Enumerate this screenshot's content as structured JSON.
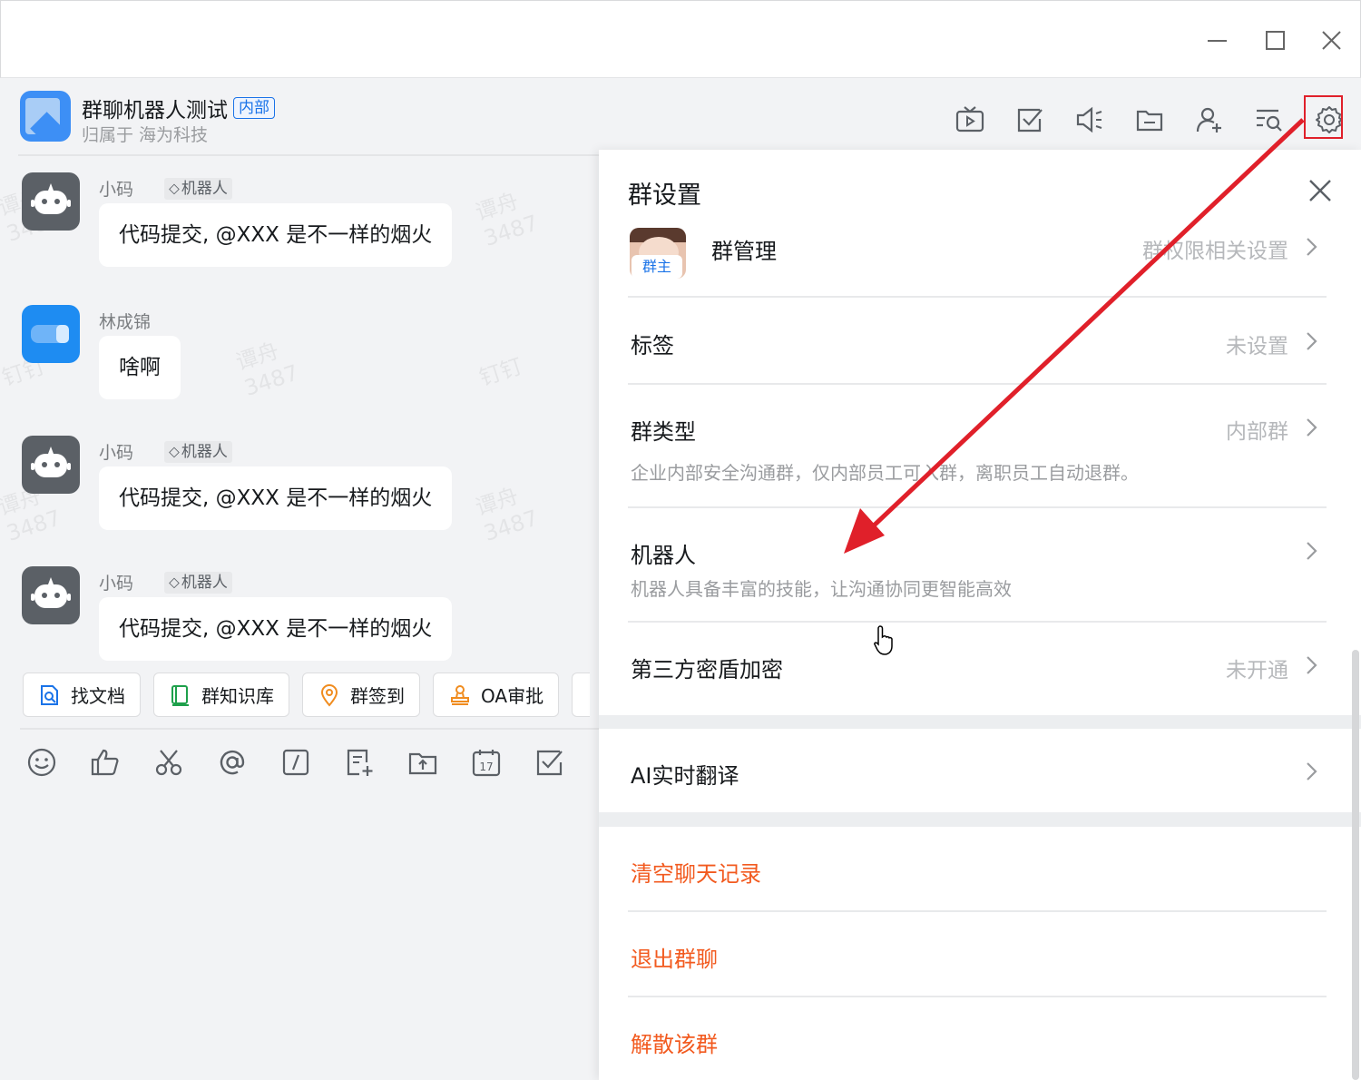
{
  "window": {
    "minimize_label": "minimize",
    "maximize_label": "maximize",
    "close_label": "close"
  },
  "header": {
    "group_name": "群聊机器人测试",
    "badge": "内部",
    "subtitle": "归属于 海为科技",
    "icons": [
      "live-icon",
      "todo-icon",
      "announcement-icon",
      "folder-icon",
      "add-member-icon",
      "search-history-icon",
      "gear-icon"
    ]
  },
  "messages": [
    {
      "sender": "小码",
      "tag": "机器人",
      "text": "代码提交, @XXX 是不一样的烟火",
      "type": "robot"
    },
    {
      "sender": "林成锦",
      "tag": "",
      "text": "啥啊",
      "type": "user"
    },
    {
      "sender": "小码",
      "tag": "机器人",
      "text": "代码提交, @XXX 是不一样的烟火",
      "type": "robot"
    },
    {
      "sender": "小码",
      "tag": "机器人",
      "text": "代码提交, @XXX 是不一样的烟火",
      "type": "robot"
    }
  ],
  "watermarks": [
    "谭舟\n3487",
    "钉钉"
  ],
  "quick_actions": [
    {
      "label": "找文档",
      "icon": "doc-search-icon",
      "color": "#1a73e8"
    },
    {
      "label": "群知识库",
      "icon": "knowledge-base-icon",
      "color": "#1ea04b"
    },
    {
      "label": "群签到",
      "icon": "checkin-icon",
      "color": "#f08c1f"
    },
    {
      "label": "OA审批",
      "icon": "approval-icon",
      "color": "#f08c1f"
    }
  ],
  "toolbar_icons": [
    "emoji-icon",
    "thumbs-up-icon",
    "scissors-icon",
    "at-icon",
    "slash-command-icon",
    "new-doc-icon",
    "upload-icon",
    "calendar-icon",
    "task-check-icon"
  ],
  "calendar_day": "17",
  "settings": {
    "title": "群设置",
    "group_manage": {
      "label": "群管理",
      "owner_tag": "群主",
      "value": "群权限相关设置"
    },
    "tags": {
      "label": "标签",
      "value": "未设置"
    },
    "group_type": {
      "label": "群类型",
      "value": "内部群",
      "desc": "企业内部安全沟通群，仅内部员工可入群，离职员工自动退群。"
    },
    "robot": {
      "label": "机器人",
      "desc": "机器人具备丰富的技能，让沟通协同更智能高效"
    },
    "third_party": {
      "label": "第三方密盾加密",
      "value": "未开通"
    },
    "ai_translate": {
      "label": "AI实时翻译"
    },
    "clear_history": {
      "label": "清空聊天记录"
    },
    "quit_group": {
      "label": "退出群聊"
    },
    "dissolve_group": {
      "label": "解散该群"
    }
  },
  "colors": {
    "accent_blue": "#1a73e8",
    "danger_orange": "#f25a1f",
    "annotation_red": "#e0202a"
  }
}
